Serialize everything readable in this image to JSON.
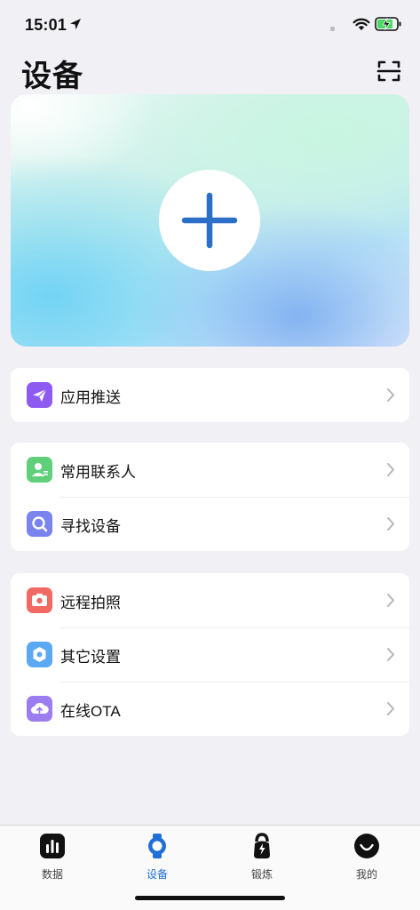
{
  "status_bar": {
    "time": "15:01"
  },
  "header": {
    "title": "设备"
  },
  "colors": {
    "accent": "#1f6fd6",
    "push_icon": "#8e5bf0",
    "contacts_icon": "#5fcf7a",
    "find_icon": "#7a84ee",
    "camera_icon": "#f06a63",
    "settings_icon": "#5aa9f2",
    "ota_icon": "#9b7df0"
  },
  "menu_groups": [
    {
      "items": [
        {
          "label": "应用推送",
          "icon": "paper-plane-icon"
        }
      ]
    },
    {
      "items": [
        {
          "label": "常用联系人",
          "icon": "contact-icon"
        },
        {
          "label": "寻找设备",
          "icon": "search-icon"
        }
      ]
    },
    {
      "items": [
        {
          "label": "远程拍照",
          "icon": "camera-icon"
        },
        {
          "label": "其它设置",
          "icon": "hexagon-settings-icon"
        },
        {
          "label": "在线OTA",
          "icon": "cloud-upload-icon"
        }
      ]
    }
  ],
  "tabs": [
    {
      "label": "数据",
      "icon": "bar-chart-icon",
      "active": false
    },
    {
      "label": "设备",
      "icon": "watch-icon",
      "active": true
    },
    {
      "label": "锻炼",
      "icon": "kettlebell-icon",
      "active": false
    },
    {
      "label": "我的",
      "icon": "smile-icon",
      "active": false
    }
  ]
}
